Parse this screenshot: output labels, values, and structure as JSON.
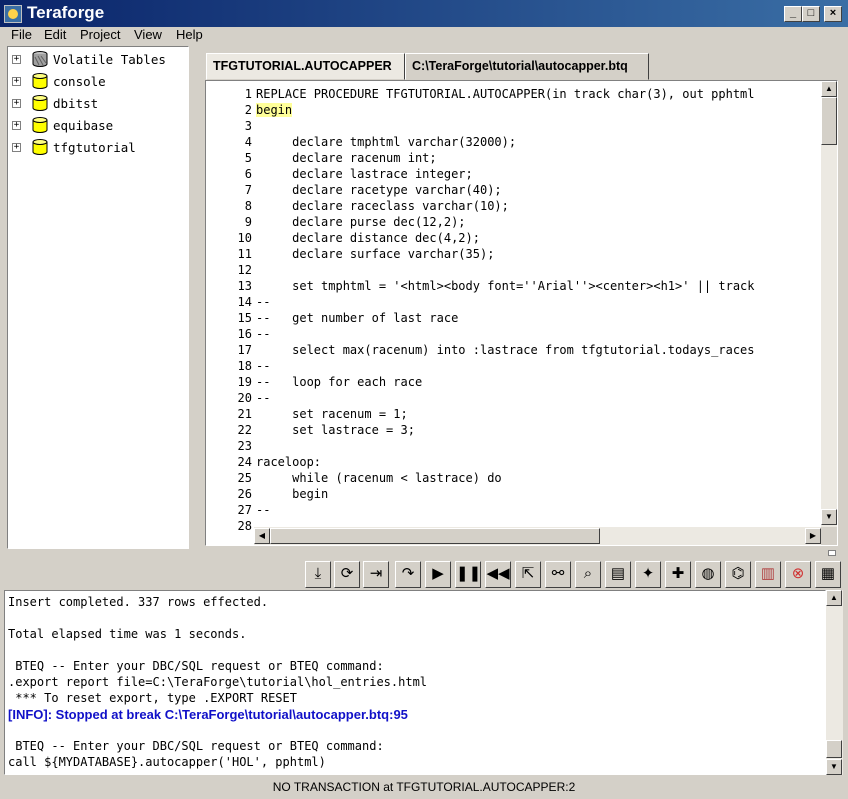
{
  "window": {
    "title": "Teraforge",
    "minimize_glyph": "_",
    "maximize_glyph": "□",
    "close_glyph": "×"
  },
  "menu": [
    "File",
    "Edit",
    "Project",
    "View",
    "Help"
  ],
  "tree": [
    {
      "label": "Volatile Tables",
      "icon": "volatile-table-icon"
    },
    {
      "label": "console",
      "icon": "database-icon"
    },
    {
      "label": "dbitst",
      "icon": "database-icon"
    },
    {
      "label": "equibase",
      "icon": "database-icon"
    },
    {
      "label": "tfgtutorial",
      "icon": "database-icon"
    }
  ],
  "tabs": [
    {
      "label": "TFGTUTORIAL.AUTOCAPPER",
      "active": true
    },
    {
      "label": "C:\\TeraForge\\tutorial\\autocapper.btq",
      "active": false
    }
  ],
  "editor": {
    "line_numbers": [
      "1",
      "2",
      "3",
      "4",
      "5",
      "6",
      "7",
      "8",
      "9",
      "10",
      "11",
      "12",
      "13",
      "14",
      "15",
      "16",
      "17",
      "18",
      "19",
      "20",
      "21",
      "22",
      "23",
      "24",
      "25",
      "26",
      "27",
      "28"
    ],
    "lines": [
      "REPLACE PROCEDURE TFGTUTORIAL.AUTOCAPPER(in track char(3), out pphtml",
      "begin",
      "",
      "     declare tmphtml varchar(32000);",
      "     declare racenum int;",
      "     declare lastrace integer;",
      "     declare racetype varchar(40);",
      "     declare raceclass varchar(10);",
      "     declare purse dec(12,2);",
      "     declare distance dec(4,2);",
      "     declare surface varchar(35);",
      "",
      "     set tmphtml = '<html><body font=''Arial''><center><h1>' || track",
      "--",
      "--   get number of last race",
      "--",
      "     select max(racenum) into :lastrace from tfgtutorial.todays_races",
      "--",
      "--   loop for each race",
      "--",
      "     set racenum = 1;",
      "     set lastrace = 3;",
      "",
      "raceloop:",
      "     while (racenum < lastrace) do",
      "     begin",
      "--",
      "     "
    ],
    "highlighted_line": 2
  },
  "toolbar": [
    "compile-icon",
    "recompile-icon",
    "step-into-icon",
    "step-over-icon",
    "run-icon",
    "pause-icon",
    "rewind-icon",
    "step-out-icon",
    "binoculars-icon",
    "magnifier-icon",
    "document-icon",
    "magic-wand-icon",
    "puzzle-icon",
    "globe-icon",
    "network-icon",
    "chart-icon",
    "stop-icon",
    "grid-icon"
  ],
  "output": {
    "lines": [
      {
        "text": "Insert completed. 337 rows effected.",
        "kind": "normal"
      },
      {
        "text": "",
        "kind": "normal"
      },
      {
        "text": "Total elapsed time was 1 seconds.",
        "kind": "normal"
      },
      {
        "text": "",
        "kind": "normal"
      },
      {
        "text": " BTEQ -- Enter your DBC/SQL request or BTEQ command:",
        "kind": "normal"
      },
      {
        "text": ".export report file=C:\\TeraForge\\tutorial\\hol_entries.html",
        "kind": "normal"
      },
      {
        "text": " *** To reset export, type .EXPORT RESET",
        "kind": "normal"
      },
      {
        "text": "[INFO]: Stopped at break C:\\TeraForge\\tutorial\\autocapper.btq:95",
        "kind": "info"
      },
      {
        "text": "",
        "kind": "normal"
      },
      {
        "text": " BTEQ -- Enter your DBC/SQL request or BTEQ command:",
        "kind": "normal"
      },
      {
        "text": "call ${MYDATABASE}.autocapper('HOL', pphtml)",
        "kind": "normal"
      }
    ]
  },
  "status": "NO TRANSACTION at TFGTUTORIAL.AUTOCAPPER:2",
  "colors": {
    "titlebar": "#0a246a",
    "face": "#d4d0c8",
    "highlight_line": "#ffff99",
    "info_text": "#1010c8",
    "db_icon": "#ffff00"
  }
}
